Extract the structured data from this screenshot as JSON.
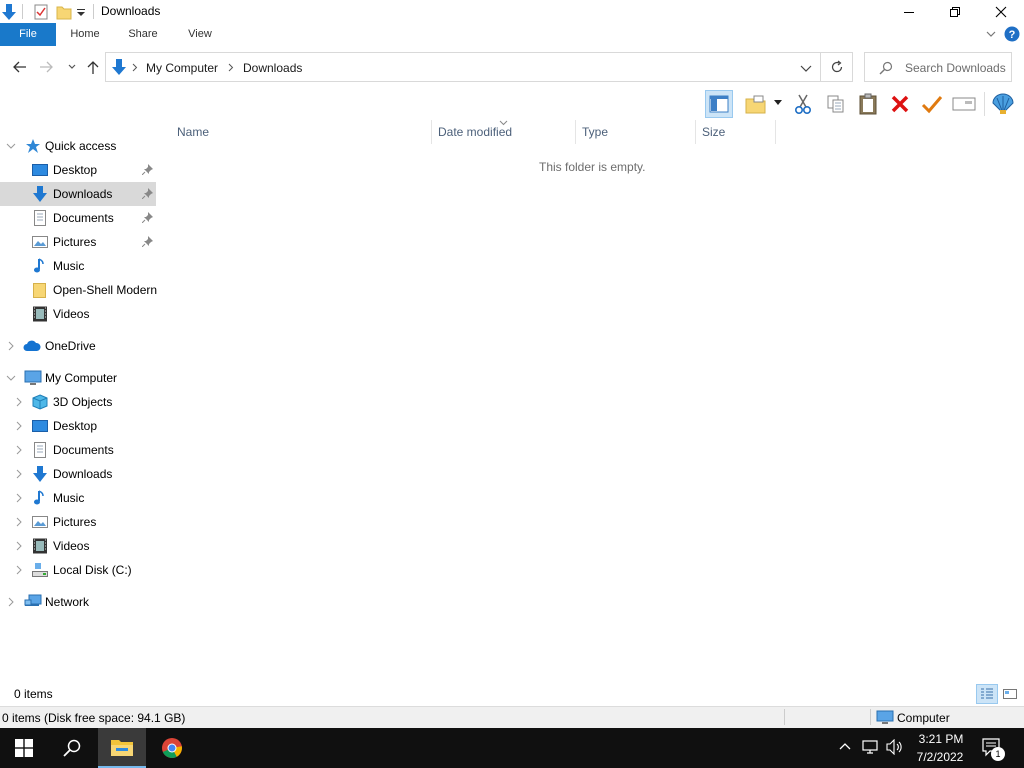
{
  "window": {
    "title": "Downloads"
  },
  "ribbon": {
    "tabs": [
      "File",
      "Home",
      "Share",
      "View"
    ]
  },
  "address": {
    "crumbs": [
      "My Computer",
      "Downloads"
    ],
    "search_placeholder": "Search Downloads"
  },
  "navpane": {
    "quick_access": "Quick access",
    "quick_items": [
      "Desktop",
      "Downloads",
      "Documents",
      "Pictures",
      "Music",
      "Open-Shell Modern",
      "Videos"
    ],
    "onedrive": "OneDrive",
    "my_computer": "My Computer",
    "computer_items": [
      "3D Objects",
      "Desktop",
      "Documents",
      "Downloads",
      "Music",
      "Pictures",
      "Videos",
      "Local Disk (C:)"
    ],
    "network": "Network"
  },
  "content": {
    "columns": [
      "Name",
      "Date modified",
      "Type",
      "Size"
    ],
    "empty_message": "This folder is empty."
  },
  "status": {
    "item_count": "0 items",
    "disk_info": "0 items (Disk free space: 94.1 GB)",
    "location": "Computer"
  },
  "taskbar": {
    "time": "3:21 PM",
    "date": "7/2/2022",
    "notification_count": "1"
  },
  "colors": {
    "file_tab": "#1979ca",
    "selection": "#d9d9d9",
    "taskbar": "#101010"
  }
}
